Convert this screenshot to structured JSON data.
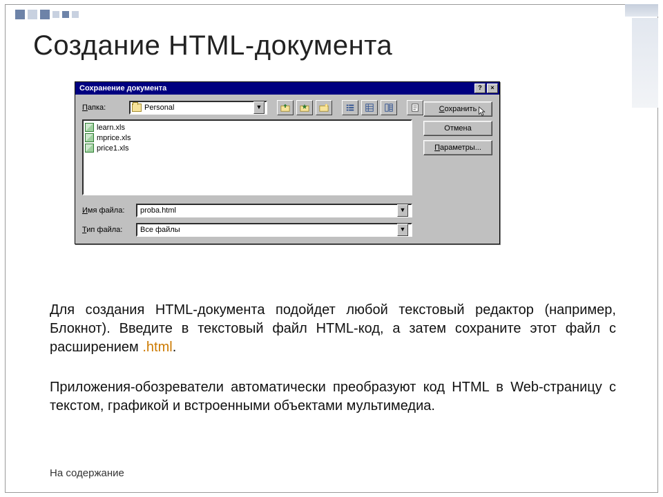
{
  "slide": {
    "title": "Создание HTML-документа",
    "paragraph1_a": "Для создания HTML-документа подойдет любой текстовый редактор (например, Блокнот). Введите в текстовый файл HTML-код, а затем сохраните этот файл с расширением ",
    "paragraph1_ext": ".html",
    "paragraph1_b": ".",
    "paragraph2": " Приложения-обозреватели автоматически преобразуют код HTML в Web-страницу с текстом, графикой и встроенными объектами мультимедиа.",
    "toc_link": "На содержание"
  },
  "dialog": {
    "title": "Сохранение документа",
    "titlebar_help": "?",
    "titlebar_close": "×",
    "folder_label_prefix": "П",
    "folder_label_rest": "апка:",
    "folder_value": "Personal",
    "files": [
      {
        "name": "learn.xls"
      },
      {
        "name": "mprice.xls"
      },
      {
        "name": "price1.xls"
      }
    ],
    "filename_label_prefix": "И",
    "filename_label_rest": "мя файла:",
    "filename_value": "proba.html",
    "filetype_label_prefix": "Т",
    "filetype_label_rest": "ип файла:",
    "filetype_value": "Все файлы",
    "btn_save_prefix": "С",
    "btn_save_rest": "охранить",
    "btn_cancel": "Отмена",
    "btn_options_prefix": "П",
    "btn_options_rest": "араметры..."
  }
}
